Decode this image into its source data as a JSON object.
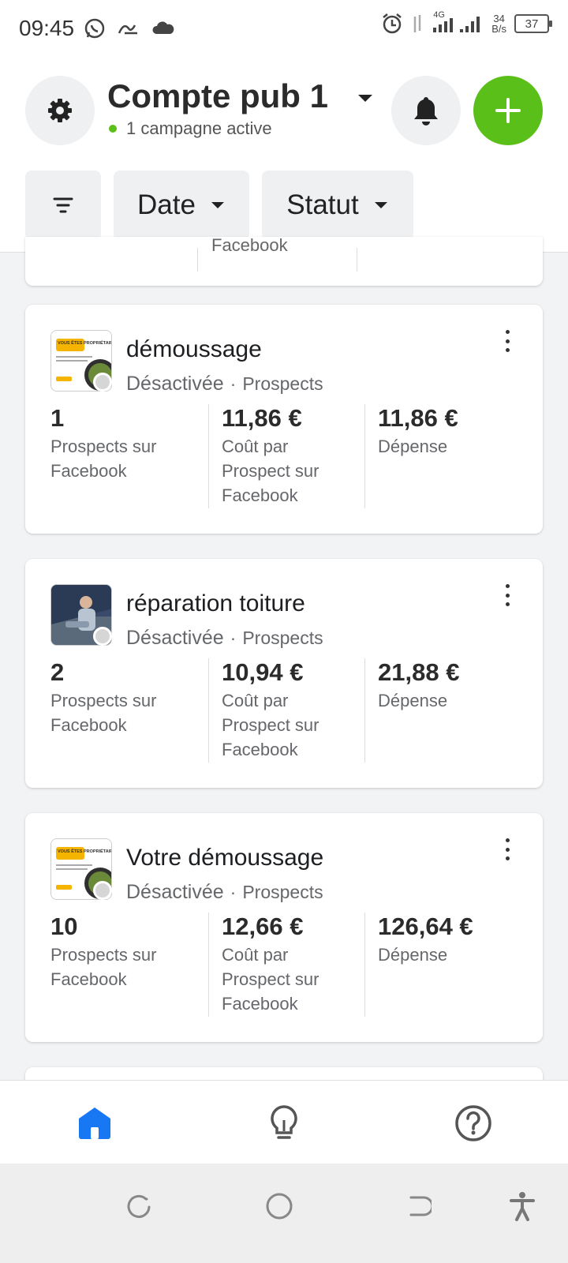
{
  "status_bar": {
    "time": "09:45",
    "net_speed_value": "34",
    "net_speed_unit": "B/s",
    "network_type": "4G",
    "battery": "37"
  },
  "header": {
    "account_name": "Compte pub 1",
    "active_campaigns": "1 campagne active"
  },
  "filters": {
    "date_label": "Date",
    "status_label": "Statut"
  },
  "partial_card": {
    "text": "Facebook"
  },
  "campaigns": [
    {
      "name": "démoussage",
      "status": "Désactivée",
      "objective": "Prospects",
      "metrics": [
        {
          "value": "1",
          "label": "Prospects sur Facebook"
        },
        {
          "value": "11,86 €",
          "label": "Coût par Prospect sur Facebook"
        },
        {
          "value": "11,86 €",
          "label": "Dépense"
        }
      ]
    },
    {
      "name": "réparation toiture",
      "status": "Désactivée",
      "objective": "Prospects",
      "metrics": [
        {
          "value": "2",
          "label": "Prospects sur Facebook"
        },
        {
          "value": "10,94 €",
          "label": "Coût par Prospect sur Facebook"
        },
        {
          "value": "21,88 €",
          "label": "Dépense"
        }
      ]
    },
    {
      "name": "Votre démoussage",
      "status": "Désactivée",
      "objective": "Prospects",
      "metrics": [
        {
          "value": "10",
          "label": "Prospects sur Facebook"
        },
        {
          "value": "12,66 €",
          "label": "Coût par Prospect sur Facebook"
        },
        {
          "value": "126,64 €",
          "label": "Dépense"
        }
      ]
    }
  ],
  "thumb_text": {
    "ad_headline": "VOUS ÊTES PROPRIÉTAIRE ?"
  },
  "bottom_nav": {
    "icons": [
      "home-icon",
      "lightbulb-icon",
      "help-icon"
    ]
  },
  "colors": {
    "accent_green": "#5bbf1a",
    "nav_active_blue": "#1877f2",
    "status_inactive": "#d6d6d6"
  }
}
